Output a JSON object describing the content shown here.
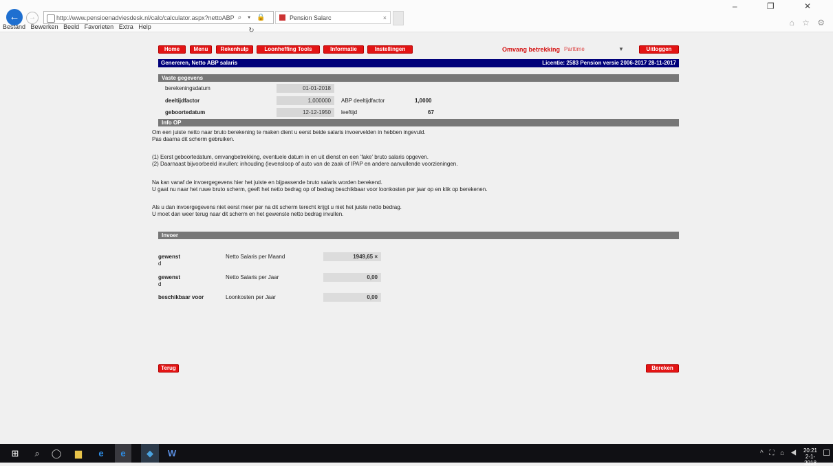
{
  "browser": {
    "url": "http://www.pensioenadviesdesk.nl/calc/calculator.aspx?nettoABP",
    "tab_title": "Pension Salarc",
    "menu": [
      "Bestand",
      "Bewerken",
      "Beeld",
      "Favorieten",
      "Extra",
      "Help"
    ],
    "window_controls": "– ❐ ✕",
    "address_tools": "⌕ ▾ 🔒 ↻",
    "fav_icons": "⌂ ☆ ⚙"
  },
  "nav": {
    "buttons": [
      "Home",
      "Menu",
      "Rekenhulp",
      "Loonheffing Tools",
      "Informatie",
      "Instellingen"
    ],
    "kind_label": "Omvang betrekking",
    "kind_value": "Parttime",
    "logout": "Uitloggen"
  },
  "title": {
    "left": "Genereren, Netto ABP salaris",
    "right": "Licentie: 2583  Pension versie 2006-2017  28-11-2017"
  },
  "vaste": {
    "header": "Vaste gegevens",
    "berekeningsdatum_label": "berekeningsdatum",
    "berekeningsdatum": "01-01-2018",
    "deeltijdfactor_label": "deeltijdfactor",
    "deeltijdfactor": "1,000000",
    "abp_label": "ABP deeltijdfactor",
    "abp": "1,0000",
    "geboortedatum_label": "geboortedatum",
    "geboortedatum": "12-12-1950",
    "leeftijd_label": "leeftijd",
    "leeftijd": "67"
  },
  "info": {
    "header": "Info OP",
    "lines": [
      "Om een juiste netto naar bruto berekening te maken dient u eerst beide salaris invoervelden in hebben ingevuld.",
      "Pas daarna dit scherm gebruiken.",
      "",
      "(1) Eerst geboortedatum, omvangbetrekking, eventuele datum in en uit dienst en een 'fake' bruto salaris opgeven.",
      "(2) Daarnaast bijvoorbeeld invullen: inhouding (levensloop of auto van de zaak of IPAP en andere aanvullende voorzieningen.",
      "",
      "Na kan vanaf de invoergegevens hier het juiste en bijpassende bruto salaris worden berekend.",
      "U gaat nu naar het ruwe bruto scherm, geeft het netto bedrag op of bedrag beschikbaar voor loonkosten per jaar op en klik op berekenen.",
      "",
      "Als u dan invoergegevens niet eerst meer per na dit scherm terecht krijgt u niet het juiste netto bedrag.",
      "U moet dan weer terug naar dit scherm en het gewenste netto bedrag invullen."
    ]
  },
  "invoer": {
    "header": "Invoer",
    "rows": [
      {
        "label": "gewenst",
        "sub": "d",
        "field": "Netto Salaris per Maand",
        "value": "1949,65 ×"
      },
      {
        "label": "gewenst",
        "sub": "d",
        "field": "Netto Salaris per Jaar",
        "value": "0,00"
      },
      {
        "label": "beschikbaar voor",
        "sub": "",
        "field": "Loonkosten per Jaar",
        "value": "0,00"
      }
    ]
  },
  "footer": {
    "back": "Terug",
    "calc": "Bereken"
  },
  "taskbar": {
    "tray": "^ ⛶ ⌂ ◀",
    "time": "20:21",
    "date": "2-1-2018",
    "notify": "☐"
  }
}
